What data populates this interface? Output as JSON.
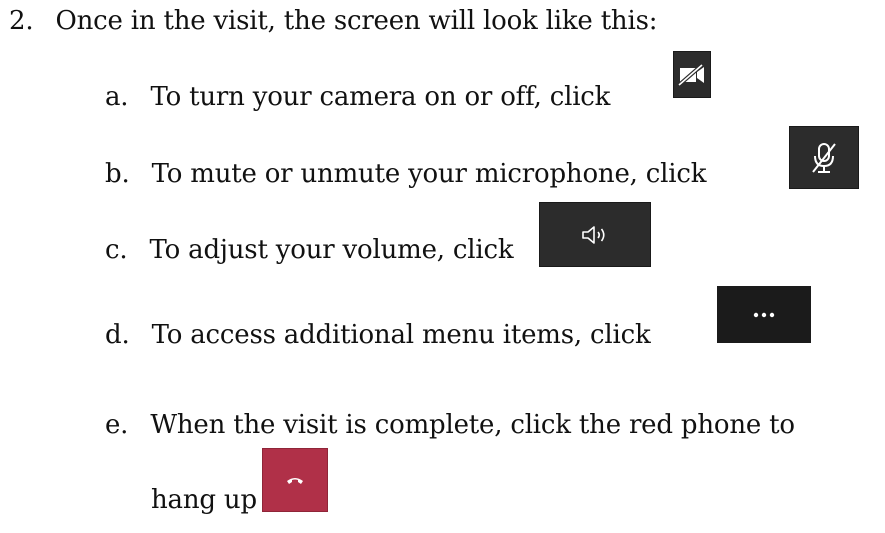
{
  "step": {
    "number": "2.",
    "text": "Once in the visit, the screen will look like this:"
  },
  "items": [
    {
      "marker": "a.",
      "text": "To turn your camera on or off, click",
      "icon": "camera-off-icon"
    },
    {
      "marker": "b.",
      "text": "To mute or unmute your microphone, click",
      "icon": "microphone-muted-icon"
    },
    {
      "marker": "c.",
      "text": "To adjust your volume, click",
      "icon": "speaker-icon"
    },
    {
      "marker": "d.",
      "text": "To access additional menu items, click",
      "icon": "more-options-icon"
    },
    {
      "marker": "e.",
      "text": "When the visit is complete, click the red phone to",
      "text_cont": "hang up",
      "icon": "hang-up-phone-icon"
    }
  ],
  "colors": {
    "button_dark": "#2c2c2c",
    "button_black": "#1b1b1b",
    "hang_up_red": "#b03048",
    "icon_white": "#ffffff"
  }
}
